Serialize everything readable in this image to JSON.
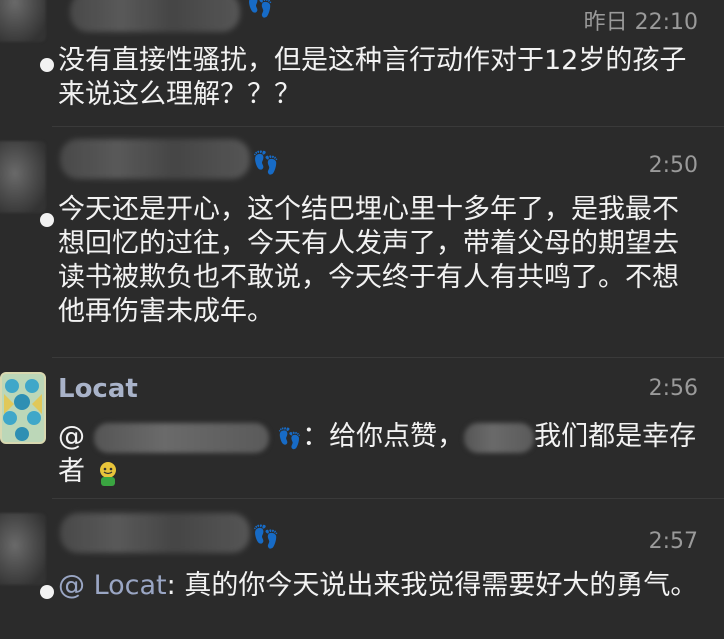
{
  "messages": [
    {
      "time": "昨日 22:10",
      "text": "没有直接性骚扰，但是这种言行动作对于12岁的孩子来说这么理解？？？"
    },
    {
      "time": "2:50",
      "text": "今天还是开心，这个结巴埋心里十多年了，是我最不想回忆的过往，今天有人发声了，带着父母的期望去读书被欺负也不敢说，今天终于有人有共鸣了。不想他再伤害未成年。"
    },
    {
      "name": "Locat",
      "time": "2:56",
      "text_prefix": "@",
      "text_mid": "：给你点赞，",
      "text_suffix": "我们都是幸存者"
    },
    {
      "time": "2:57",
      "mention": "@ Locat",
      "text": ": 真的你今天说出来我觉得需要好大的勇气。"
    }
  ],
  "icons": {
    "footprint": "footprint-icon",
    "emoji": "smiley-emoji"
  }
}
